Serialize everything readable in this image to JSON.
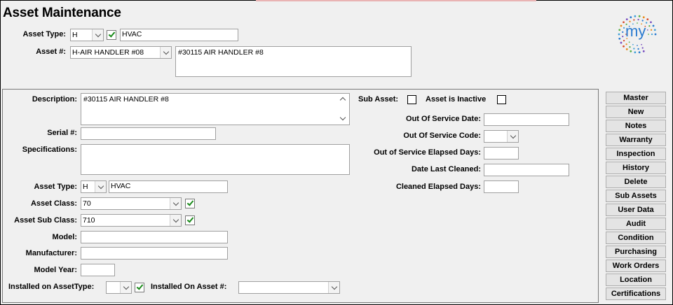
{
  "title": "Asset Maintenance",
  "header": {
    "asset_type_label": "Asset Type:",
    "asset_type_code": "H",
    "asset_type_name": "HVAC",
    "asset_num_label": "Asset #:",
    "asset_num_value": "H-AIR HANDLER #08",
    "asset_desc": "#30115 AIR HANDLER #8"
  },
  "logo": {
    "text": "my",
    "color": "#2a7bd0"
  },
  "form": {
    "description_label": "Description:",
    "description_value": "#30115 AIR HANDLER #8",
    "serial_label": "Serial #:",
    "serial_value": "",
    "specifications_label": "Specifications:",
    "specifications_value": "",
    "asset_type_label": "Asset Type:",
    "asset_type_code": "H",
    "asset_type_name": "HVAC",
    "asset_class_label": "Asset Class:",
    "asset_class_value": "70",
    "asset_sub_class_label": "Asset Sub Class:",
    "asset_sub_class_value": "710",
    "model_label": "Model:",
    "model_value": "",
    "manufacturer_label": "Manufacturer:",
    "manufacturer_value": "",
    "model_year_label": "Model Year:",
    "model_year_value": "",
    "installed_on_type_label": "Installed on AssetType:",
    "installed_on_type_value": "",
    "installed_on_asset_label": "Installed On Asset #:",
    "installed_on_asset_value": "",
    "sub_asset_label": "Sub Asset:",
    "inactive_label": "Asset is Inactive",
    "oos_date_label": "Out Of Service Date:",
    "oos_date_value": "",
    "oos_code_label": "Out Of Service Code:",
    "oos_code_value": "",
    "oos_elapsed_label": "Out of Service Elapsed Days:",
    "oos_elapsed_value": "",
    "last_cleaned_label": "Date Last Cleaned:",
    "last_cleaned_value": "",
    "cleaned_elapsed_label": "Cleaned Elapsed Days:",
    "cleaned_elapsed_value": ""
  },
  "sidebar": {
    "buttons": [
      "Master",
      "New",
      "Notes",
      "Warranty",
      "Inspection",
      "History",
      "Delete",
      "Sub Assets",
      "User Data",
      "Audit",
      "Condition",
      "Purchasing",
      "Work Orders",
      "Location",
      "Certifications"
    ]
  }
}
